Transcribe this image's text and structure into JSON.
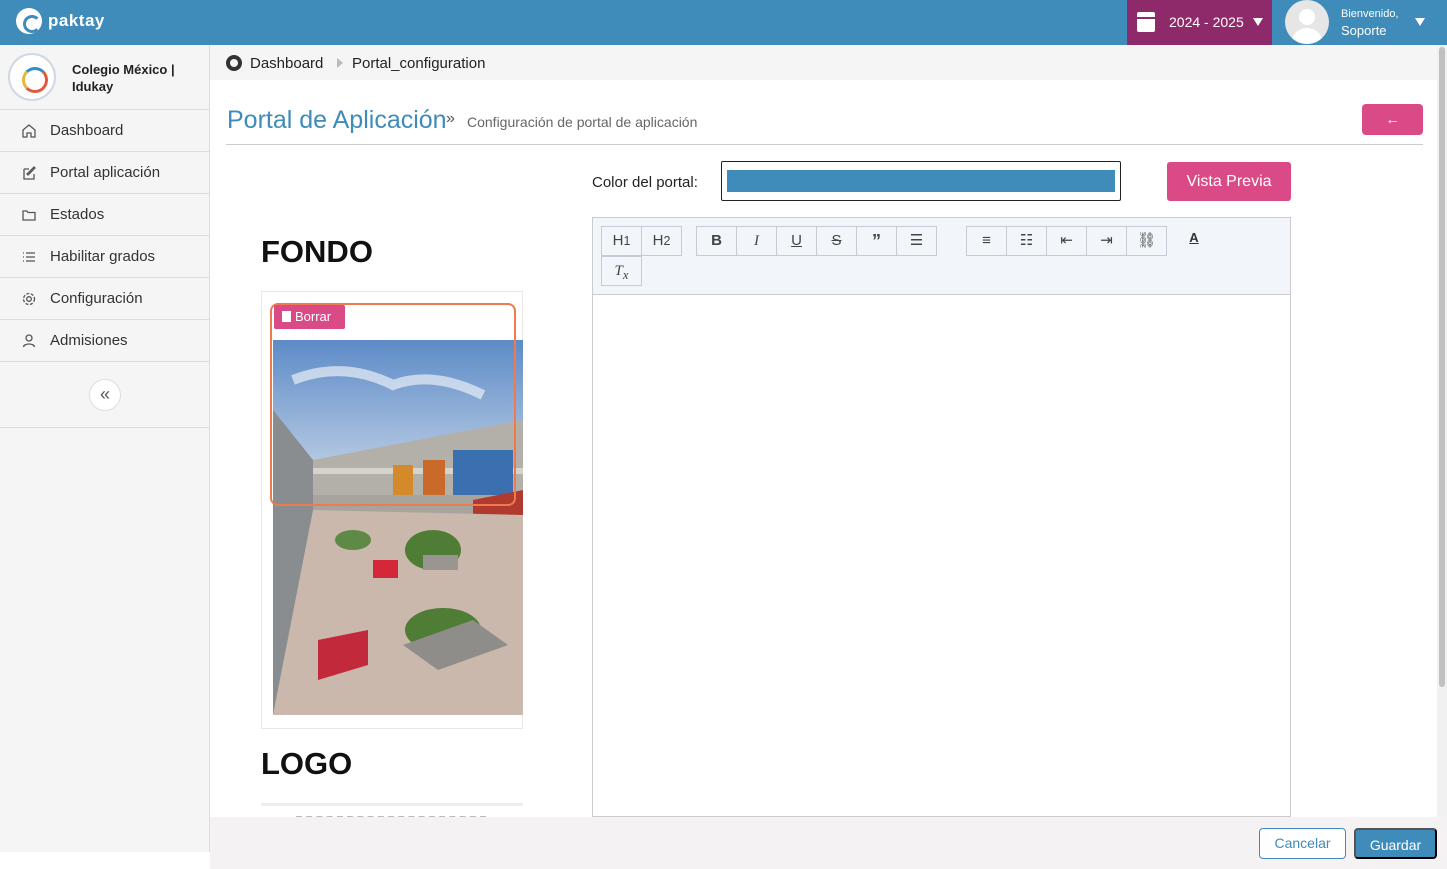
{
  "topbar": {
    "brand": "paktay",
    "school_year": "2024 - 2025",
    "welcome": "Bienvenido,",
    "username": "Soporte"
  },
  "sidebar": {
    "school_name": "Colegio México | Idukay",
    "items": [
      {
        "label": "Dashboard",
        "icon": "home-icon"
      },
      {
        "label": "Portal aplicación",
        "icon": "edit-icon"
      },
      {
        "label": "Estados",
        "icon": "folder-icon"
      },
      {
        "label": "Habilitar grados",
        "icon": "list-icon"
      },
      {
        "label": "Configuración",
        "icon": "gear-icon"
      },
      {
        "label": "Admisiones",
        "icon": "user-icon"
      }
    ]
  },
  "breadcrumb": {
    "home": "Dashboard",
    "current": "Portal_configuration"
  },
  "header": {
    "title": "Portal de Aplicación",
    "separator": "»",
    "subtitle": "Configuración de portal de aplicación",
    "back_symbol": "←"
  },
  "form": {
    "color_label": "Color del portal:",
    "color_value": "#3f8bba",
    "preview_label": "Vista Previa"
  },
  "sections": {
    "fondo_title": "FONDO",
    "logo_title": "LOGO",
    "delete_label": "Borrar"
  },
  "editor": {
    "toolbar": [
      "H1",
      "H2",
      "B",
      "I",
      "U",
      "S",
      "quote",
      "align",
      "ordered-list",
      "bullet-list",
      "outdent",
      "indent",
      "link",
      "text-color",
      "clear-format"
    ]
  },
  "footer": {
    "cancel_label": "Cancelar",
    "save_label": "Guardar"
  },
  "colors": {
    "brand_blue": "#3f8bba",
    "accent_pink": "#d94a86",
    "year_purple": "#8e2a6a",
    "highlight_orange": "#ee7a4f"
  }
}
